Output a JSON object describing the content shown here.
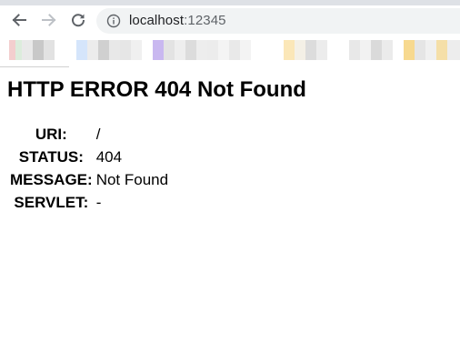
{
  "browser": {
    "url_host": "localhost",
    "url_port": ":12345",
    "icons": {
      "back": "arrow-left-icon",
      "forward": "arrow-right-icon",
      "reload": "reload-icon",
      "site_info": "info-circle-icon"
    },
    "colors": {
      "tab_strip": "#dee1e6",
      "omnibox": "#f1f3f4",
      "icon": "#5f6368",
      "icon_disabled": "#bdc1c6"
    }
  },
  "page": {
    "title": "HTTP ERROR 404 Not Found",
    "rows": [
      {
        "label": "URI:",
        "value": "/"
      },
      {
        "label": "STATUS:",
        "value": "404"
      },
      {
        "label": "MESSAGE:",
        "value": "Not Found"
      },
      {
        "label": "SERVLET:",
        "value": "-"
      }
    ]
  }
}
